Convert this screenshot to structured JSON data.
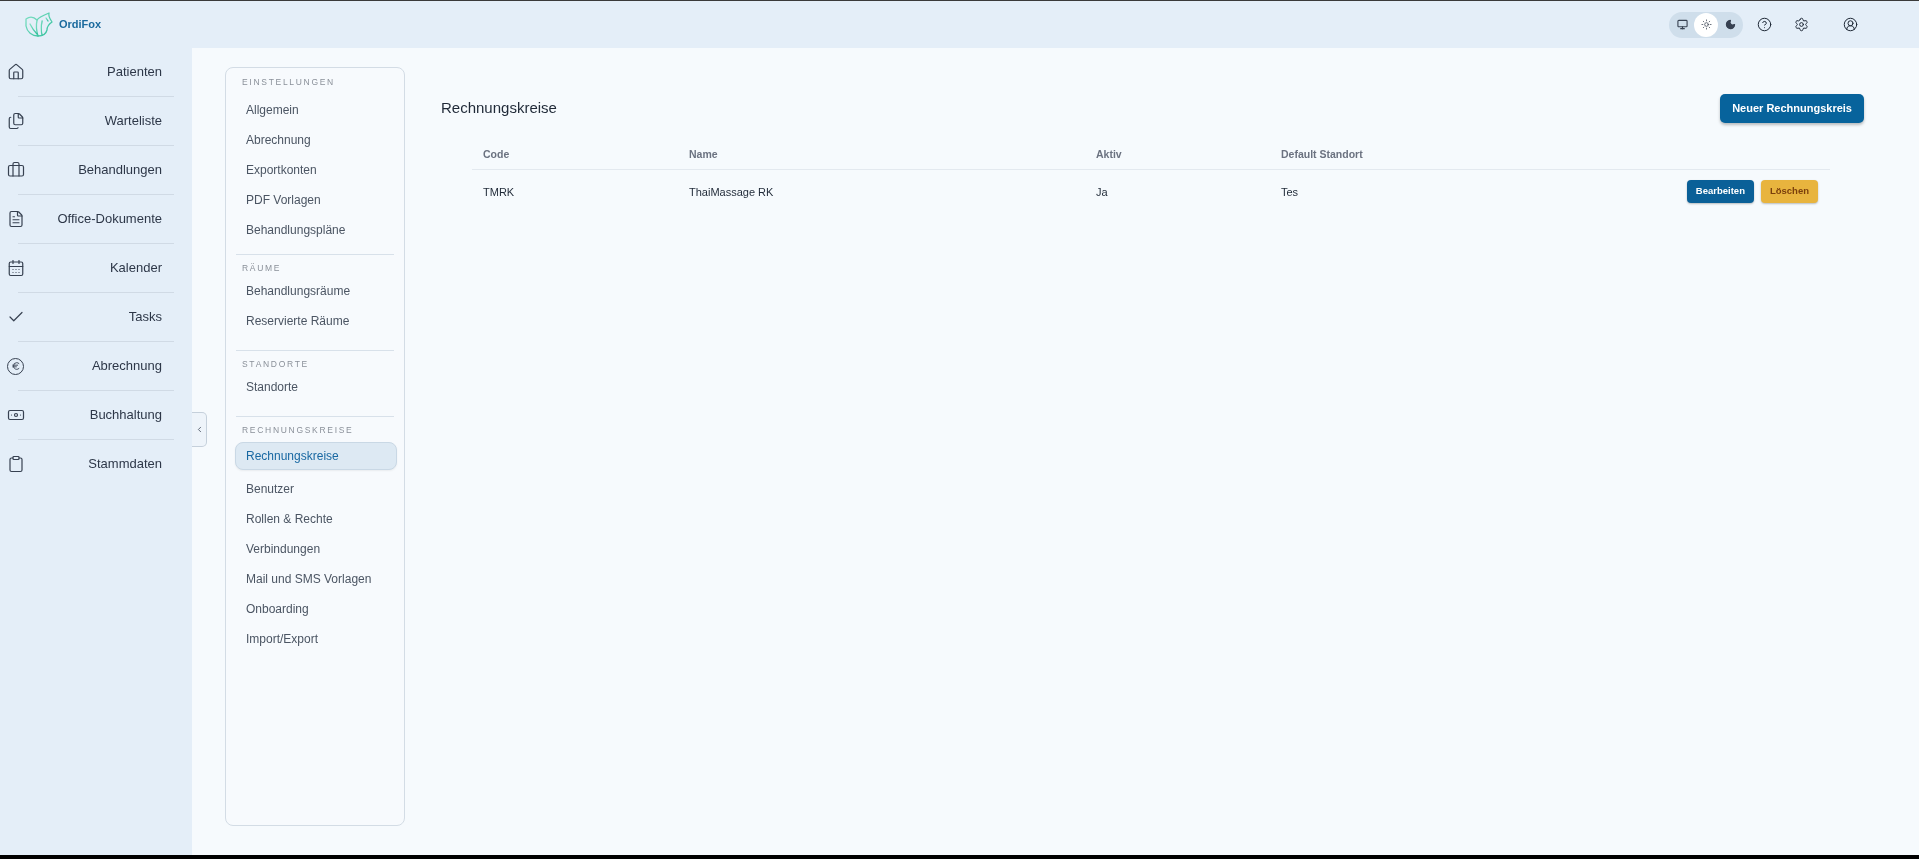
{
  "app": {
    "name": "OrdiFox"
  },
  "header": {
    "theme_options": [
      {
        "selected": false
      },
      {
        "selected": true
      },
      {
        "selected": false
      }
    ]
  },
  "sidebar": {
    "items": [
      {
        "label": "Patienten"
      },
      {
        "label": "Warteliste"
      },
      {
        "label": "Behandlungen"
      },
      {
        "label": "Office-Dokumente"
      },
      {
        "label": "Kalender"
      },
      {
        "label": "Tasks"
      },
      {
        "label": "Abrechnung"
      },
      {
        "label": "Buchhaltung"
      },
      {
        "label": "Stammdaten"
      }
    ]
  },
  "settings_nav": {
    "sections": [
      {
        "title": "EINSTELLUNGEN",
        "items": [
          {
            "label": "Allgemein",
            "selected": false
          },
          {
            "label": "Abrechnung",
            "selected": false
          },
          {
            "label": "Exportkonten",
            "selected": false
          },
          {
            "label": "PDF Vorlagen",
            "selected": false
          },
          {
            "label": "Behandlungspläne",
            "selected": false
          }
        ]
      },
      {
        "title": "RÄUME",
        "items": [
          {
            "label": "Behandlungsräume",
            "selected": false
          },
          {
            "label": "Reservierte Räume",
            "selected": false
          }
        ]
      },
      {
        "title": "STANDORTE",
        "items": [
          {
            "label": "Standorte",
            "selected": false
          }
        ]
      },
      {
        "title": "RECHNUNGSKREISE",
        "items": [
          {
            "label": "Rechnungskreise",
            "selected": true
          },
          {
            "label": "Benutzer",
            "selected": false
          },
          {
            "label": "Rollen & Rechte",
            "selected": false
          },
          {
            "label": "Verbindungen",
            "selected": false
          },
          {
            "label": "Mail und SMS Vorlagen",
            "selected": false
          },
          {
            "label": "Onboarding",
            "selected": false
          },
          {
            "label": "Import/Export",
            "selected": false
          }
        ]
      }
    ]
  },
  "page": {
    "title": "Rechnungskreise",
    "new_button": "Neuer Rechnungskreis"
  },
  "table": {
    "columns": [
      "Code",
      "Name",
      "Aktiv",
      "Default Standort"
    ],
    "rows": [
      {
        "cells": [
          "TMRK",
          "ThaiMassage RK",
          "Ja",
          "Tes"
        ],
        "actions": [
          {
            "label": "Bearbeiten",
            "kind": "primary"
          },
          {
            "label": "Löschen",
            "kind": "warning"
          }
        ]
      }
    ]
  }
}
